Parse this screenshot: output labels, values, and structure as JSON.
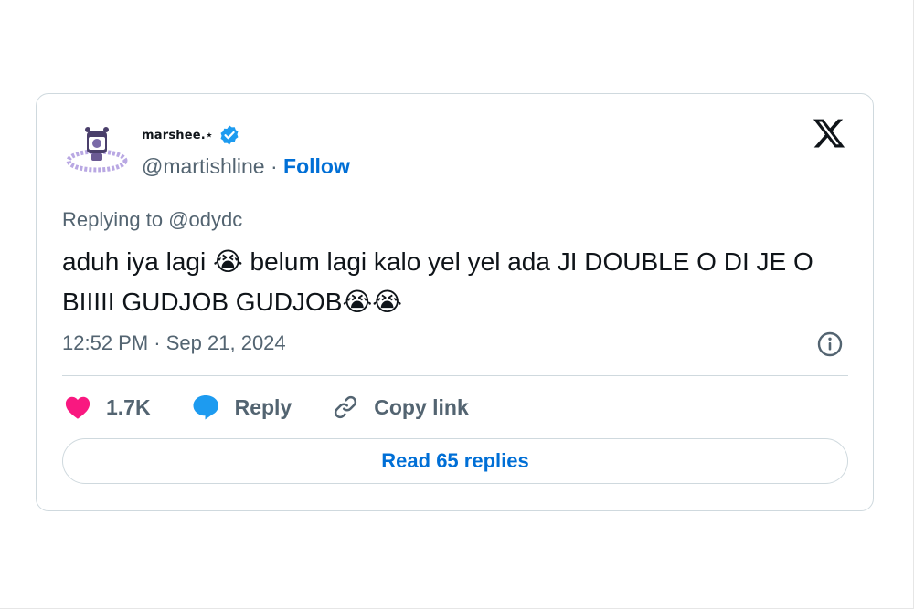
{
  "author": {
    "display_name": "marshee.⋆",
    "handle": "@martishline",
    "verified": true,
    "follow_label": "Follow",
    "separator": "·"
  },
  "tweet": {
    "replying_to_prefix": "Replying to",
    "replying_to_handle": "@odydc",
    "text": "aduh iya lagi 😭 belum lagi kalo yel yel ada JI DOUBLE O DI JE O BIIIII GUDJOB GUDJOB😭😭",
    "time": "12:52 PM",
    "date": "Sep 21, 2024"
  },
  "actions": {
    "like_count": "1.7K",
    "reply_label": "Reply",
    "copy_label": "Copy link"
  },
  "read_replies_label": "Read 65 replies",
  "icons": {
    "like": "heart-icon",
    "reply": "speech-bubble-icon",
    "copy": "link-icon",
    "info": "info-icon",
    "brand": "x-logo-icon",
    "verified": "verified-badge-icon"
  },
  "colors": {
    "accent": "#006fd6",
    "like": "#f91880",
    "reply": "#1d9bf0",
    "muted": "#536471",
    "border": "#cfd9de",
    "text": "#0f1419",
    "verified": "#1d9bf0"
  }
}
